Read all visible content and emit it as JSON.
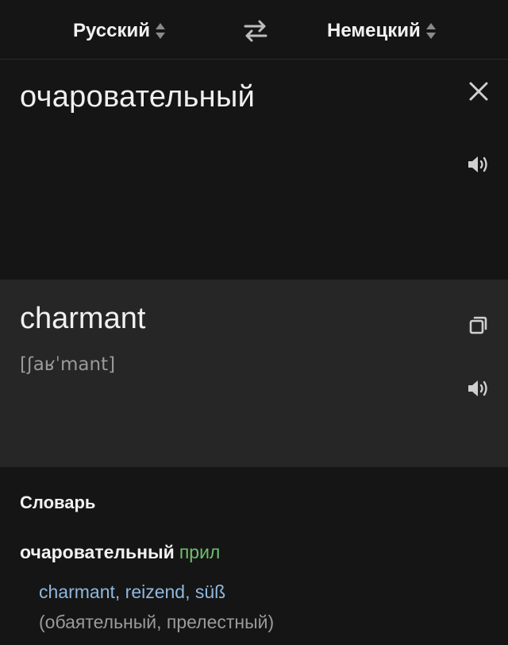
{
  "languages": {
    "source": "Русский",
    "target": "Немецкий"
  },
  "icons": {
    "sort": "sort-updown-icon",
    "swap": "swap-arrows-icon",
    "clear": "close-icon",
    "speaker": "speaker-icon",
    "copy": "copy-icon"
  },
  "source": {
    "text": "очаровательный"
  },
  "translation": {
    "text": "charmant",
    "phonetic": "[ʃaʁˈmant]"
  },
  "dictionary": {
    "title": "Словарь",
    "entries": [
      {
        "word": "очаровательный",
        "pos": "прил",
        "translations": "charmant, reizend, süß",
        "synonyms": "(обаятельный, прелестный)"
      }
    ]
  },
  "colors": {
    "background": "#151515",
    "translation_panel": "#262626",
    "pos_green": "#6dbf6d",
    "link_blue": "#8fb8de",
    "muted": "#9a9a9a"
  }
}
